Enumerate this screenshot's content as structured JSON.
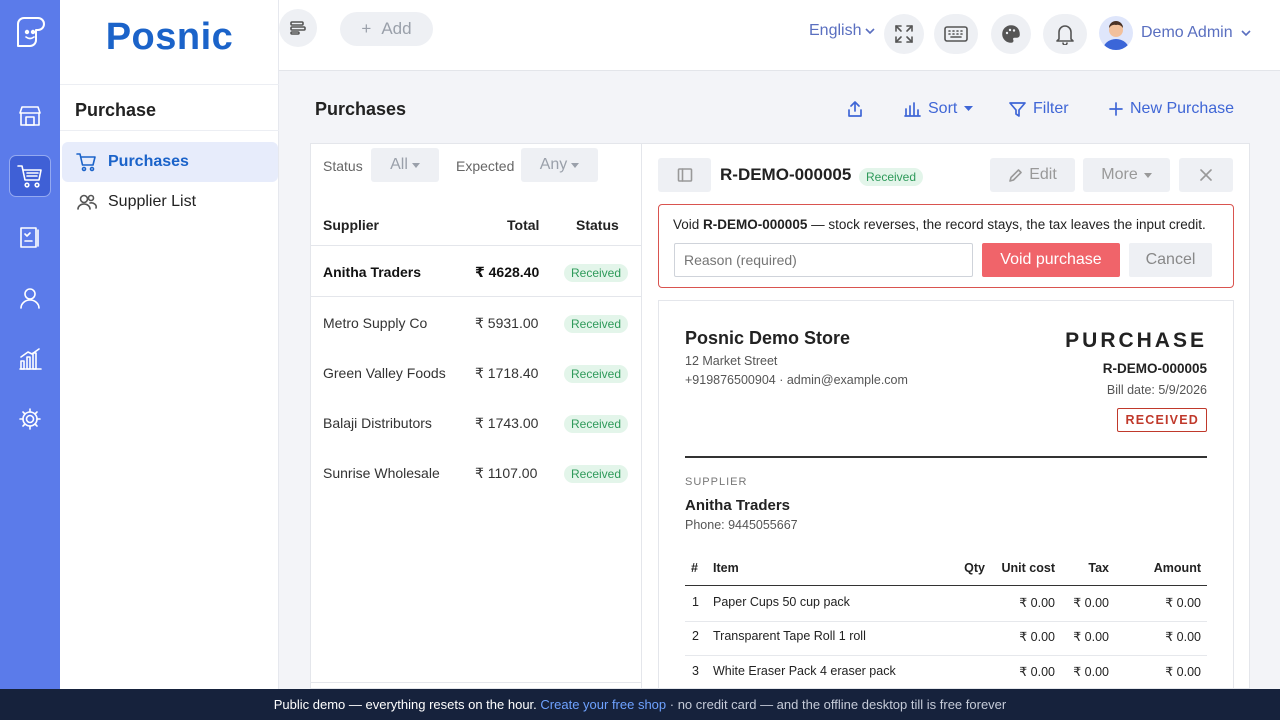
{
  "app": {
    "brand": "Posnic"
  },
  "rail": {
    "items": [
      {
        "name": "store-icon"
      },
      {
        "name": "cart-icon",
        "active": true
      },
      {
        "name": "clipboard-icon"
      },
      {
        "name": "user-icon"
      },
      {
        "name": "chart-icon"
      },
      {
        "name": "gear-icon"
      }
    ]
  },
  "sidebar": {
    "section_title": "Purchase",
    "items": [
      {
        "label": "Purchases",
        "icon": "cart-icon",
        "active": true
      },
      {
        "label": "Supplier List",
        "icon": "users-icon",
        "active": false
      }
    ]
  },
  "topbar": {
    "add_label": "Add",
    "language": "English",
    "user_name": "Demo Admin",
    "icons": [
      "menu-icon",
      "fullscreen-icon",
      "keyboard-icon",
      "palette-icon",
      "bell-icon"
    ]
  },
  "page": {
    "title": "Purchases",
    "toolbar": {
      "sort": "Sort",
      "filter": "Filter",
      "new": "New Purchase"
    }
  },
  "list": {
    "filters": {
      "status_label": "Status",
      "status_value": "All",
      "expected_label": "Expected",
      "expected_value": "Any"
    },
    "columns": {
      "supplier": "Supplier",
      "total": "Total",
      "status": "Status"
    },
    "rows": [
      {
        "supplier": "Anitha Traders",
        "total": "₹ 4628.40",
        "status": "Received",
        "selected": true
      },
      {
        "supplier": "Metro Supply Co",
        "total": "₹ 5931.00",
        "status": "Received"
      },
      {
        "supplier": "Green Valley Foods",
        "total": "₹ 1718.40",
        "status": "Received"
      },
      {
        "supplier": "Balaji Distributors",
        "total": "₹ 1743.00",
        "status": "Received"
      },
      {
        "supplier": "Sunrise Wholesale",
        "total": "₹ 1107.00",
        "status": "Received"
      }
    ]
  },
  "detail": {
    "doc_number": "R-DEMO-000005",
    "status_badge": "Received",
    "edit_label": "Edit",
    "more_label": "More",
    "void": {
      "prefix": "Void",
      "doc_number": "R-DEMO-000005",
      "message": "— stock reverses, the record stays, the tax leaves the input credit.",
      "reason_placeholder": "Reason (required)",
      "void_button": "Void purchase",
      "cancel_button": "Cancel"
    },
    "document": {
      "store_name": "Posnic Demo Store",
      "store_address": "12 Market Street",
      "store_contact": "+919876500904 · admin@example.com",
      "doc_type": "PURCHASE",
      "doc_number": "R-DEMO-000005",
      "bill_date": "Bill date: 5/9/2026",
      "stamp": "RECEIVED",
      "supplier_label": "SUPPLIER",
      "supplier_name": "Anitha Traders",
      "supplier_phone": "Phone: 9445055667",
      "item_columns": {
        "num": "#",
        "item": "Item",
        "qty": "Qty",
        "unit_cost": "Unit cost",
        "tax": "Tax",
        "amount": "Amount"
      },
      "items": [
        {
          "num": "1",
          "item": "Paper Cups 50 cup pack",
          "qty": "",
          "unit_cost": "₹ 0.00",
          "tax": "₹ 0.00",
          "amount": "₹ 0.00"
        },
        {
          "num": "2",
          "item": "Transparent Tape Roll 1 roll",
          "qty": "",
          "unit_cost": "₹ 0.00",
          "tax": "₹ 0.00",
          "amount": "₹ 0.00"
        },
        {
          "num": "3",
          "item": "White Eraser Pack 4 eraser pack",
          "qty": "",
          "unit_cost": "₹ 0.00",
          "tax": "₹ 0.00",
          "amount": "₹ 0.00"
        }
      ]
    }
  },
  "footer": {
    "text1": "Public demo — everything resets on the hour. ",
    "link": "Create your free shop",
    "text2": " · no credit card — and the offline desktop till is free forever"
  },
  "colors": {
    "rail": "#5b7bea",
    "brand": "#1b63c9",
    "accent": "#3f66d6",
    "danger": "#f0646a",
    "footer": "#16223c"
  }
}
